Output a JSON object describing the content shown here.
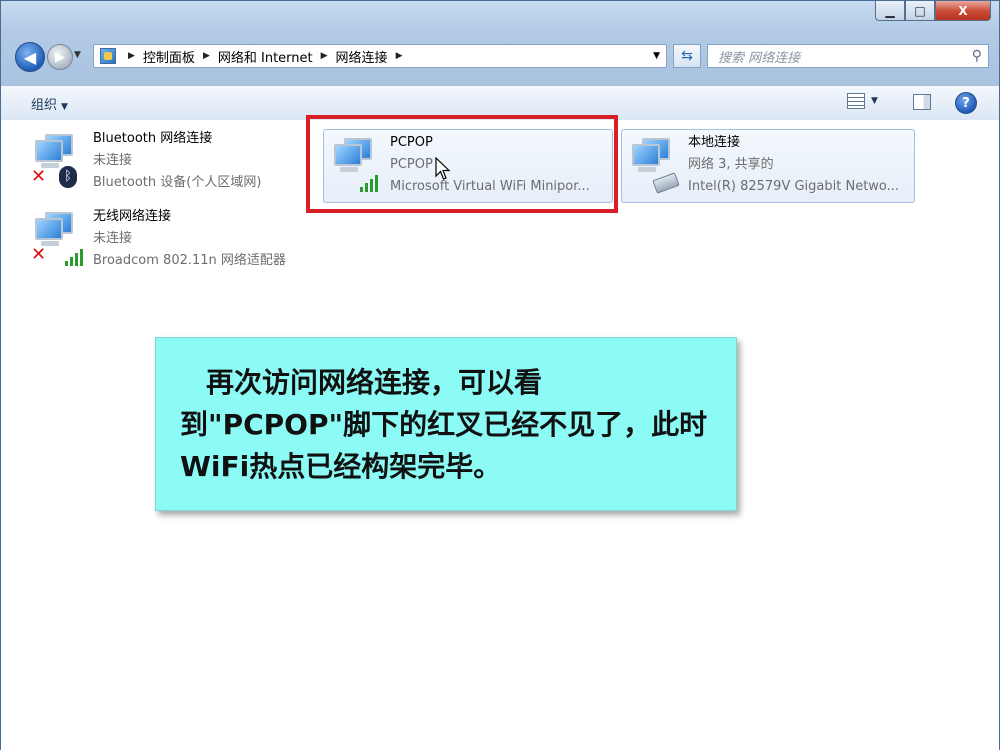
{
  "window": {
    "caption_buttons": {
      "minimize": "▁",
      "maximize": "□",
      "close": "X"
    }
  },
  "nav": {
    "back_icon": "back-arrow-icon",
    "forward_icon": "forward-arrow-icon",
    "breadcrumb": [
      "控制面板",
      "网络和 Internet",
      "网络连接"
    ],
    "search_placeholder": "搜索 网络连接"
  },
  "toolbar": {
    "organize_label": "组织"
  },
  "connections": [
    {
      "name": "Bluetooth 网络连接",
      "status": "未连接",
      "device": "Bluetooth 设备(个人区域网)"
    },
    {
      "name": "PCPOP",
      "status": "PCPOP",
      "device": "Microsoft Virtual WiFi Minipor..."
    },
    {
      "name": "本地连接",
      "status": "网络  3, 共享的",
      "device": "Intel(R) 82579V Gigabit Netwo..."
    },
    {
      "name": "无线网络连接",
      "status": "未连接",
      "device": "Broadcom 802.11n 网络适配器"
    }
  ],
  "callout": {
    "text": "再次访问网络连接，可以看到\"PCPOP\"脚下的红叉已经不见了，此时WiFi热点已经构架完毕。"
  },
  "colors": {
    "highlight_border": "#d81f26",
    "callout_bg": "#8cfbf6",
    "signal_green": "#2d9a2d",
    "error_red": "#dd1111"
  }
}
